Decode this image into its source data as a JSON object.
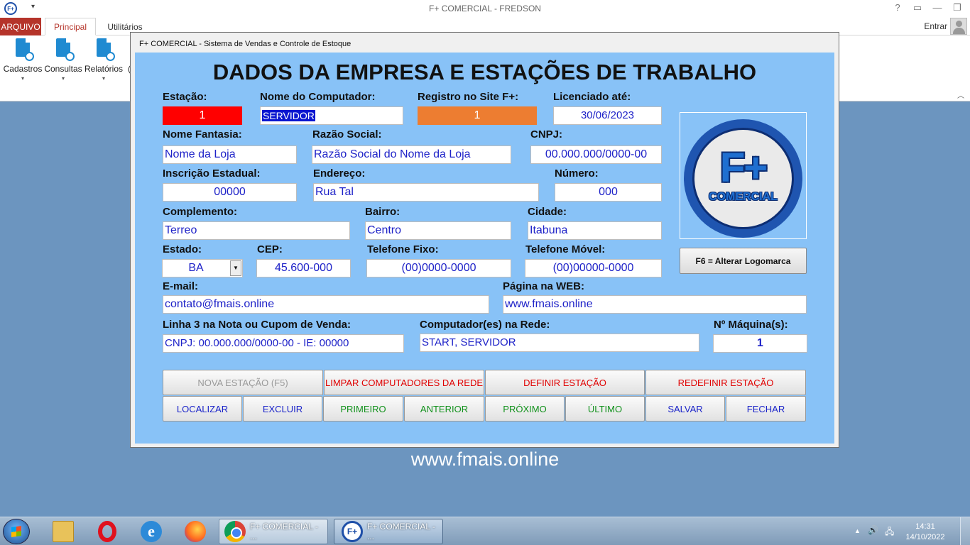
{
  "window": {
    "title": "F+ COMERCIAL - FREDSON",
    "app_icon": "F+",
    "quick_access": "▾",
    "help": "?",
    "restore_ribbon": "▭",
    "minimize": "—",
    "maximize": "❐",
    "close": "✕"
  },
  "ribbon": {
    "tabs": [
      "ARQUIVO",
      "Principal",
      "Utilitários"
    ],
    "active_tab": "Principal",
    "sign_in": "Entrar",
    "buttons": [
      {
        "label": "Cadastros",
        "icon": "add-document-icon"
      },
      {
        "label": "Consultas",
        "icon": "search-document-icon"
      },
      {
        "label": "Relatórios",
        "icon": "report-document-icon"
      }
    ],
    "truncated_label": "(",
    "dropdown_arrow": "▾",
    "collapse": "︿"
  },
  "dialog": {
    "title": "F+ COMERCIAL - Sistema de Vendas e Controle de Estoque",
    "heading": "DADOS DA EMPRESA E ESTAÇÕES DE TRABALHO",
    "fields": {
      "estacao": {
        "label": "Estação:",
        "value": "1"
      },
      "nome_computador": {
        "label": "Nome do Computador:",
        "value": "SERVIDOR"
      },
      "registro_site": {
        "label": "Registro no Site F+:",
        "value": "1"
      },
      "licenciado_ate": {
        "label": "Licenciado até:",
        "value": "30/06/2023"
      },
      "nome_fantasia": {
        "label": "Nome Fantasia:",
        "value": "Nome da Loja"
      },
      "razao_social": {
        "label": "Razão Social:",
        "value": "Razão Social do Nome da Loja"
      },
      "cnpj": {
        "label": "CNPJ:",
        "value": "00.000.000/0000-00"
      },
      "inscricao_estadual": {
        "label": "Inscrição Estadual:",
        "value": "00000"
      },
      "endereco": {
        "label": "Endereço:",
        "value": "Rua Tal"
      },
      "numero": {
        "label": "Número:",
        "value": "000"
      },
      "complemento": {
        "label": "Complemento:",
        "value": "Terreo"
      },
      "bairro": {
        "label": "Bairro:",
        "value": "Centro"
      },
      "cidade": {
        "label": "Cidade:",
        "value": "Itabuna"
      },
      "estado": {
        "label": "Estado:",
        "value": "BA",
        "arrow": "▼"
      },
      "cep": {
        "label": "CEP:",
        "value": "45.600-000"
      },
      "telefone_fixo": {
        "label": "Telefone Fixo:",
        "value": "(00)0000-0000"
      },
      "telefone_movel": {
        "label": "Telefone Móvel:",
        "value": "(00)00000-0000"
      },
      "email": {
        "label": "E-mail:",
        "value": "contato@fmais.online"
      },
      "pagina_web": {
        "label": "Página na WEB:",
        "value": "www.fmais.online"
      },
      "linha3": {
        "label": "Linha 3 na Nota ou Cupom de Venda:",
        "value": "CNPJ: 00.000.000/0000-00 - IE: 00000"
      },
      "computadores_rede": {
        "label": "Computador(es) na Rede:",
        "value": "START, SERVIDOR"
      },
      "num_maquinas": {
        "label": "Nº Máquina(s):",
        "value": "1"
      }
    },
    "logo": {
      "main": "F+",
      "sub": "COMERCIAL"
    },
    "change_logo_button": "F6 = Alterar Logomarca",
    "buttons_row1": [
      {
        "label": "NOVA ESTAÇÃO (F5)",
        "style": "disabled"
      },
      {
        "label": "LIMPAR COMPUTADORES DA REDE",
        "style": "red"
      },
      {
        "label": "DEFINIR ESTAÇÃO",
        "style": "red"
      },
      {
        "label": "REDEFINIR ESTAÇÃO",
        "style": "red"
      }
    ],
    "buttons_row2": [
      {
        "label": "LOCALIZAR",
        "style": "blue"
      },
      {
        "label": "EXCLUIR",
        "style": "blue"
      },
      {
        "label": "PRIMEIRO",
        "style": "green"
      },
      {
        "label": "ANTERIOR",
        "style": "green"
      },
      {
        "label": "PRÓXIMO",
        "style": "green"
      },
      {
        "label": "ÚLTIMO",
        "style": "green"
      },
      {
        "label": "SALVAR",
        "style": "blue"
      },
      {
        "label": "FECHAR",
        "style": "blue"
      }
    ]
  },
  "desktop_footer": "www.fmais.online",
  "taskbar": {
    "tasks": [
      {
        "label": "F+ COMERCIAL - ...",
        "icon": "chrome-icon"
      },
      {
        "label": "F+ COMERCIAL - ...",
        "icon": "fplus-icon",
        "badge": "F+"
      }
    ],
    "tray": {
      "expand": "▲",
      "volume": "🔊",
      "network": "🖧"
    },
    "time": "14:31",
    "date": "14/10/2022"
  }
}
